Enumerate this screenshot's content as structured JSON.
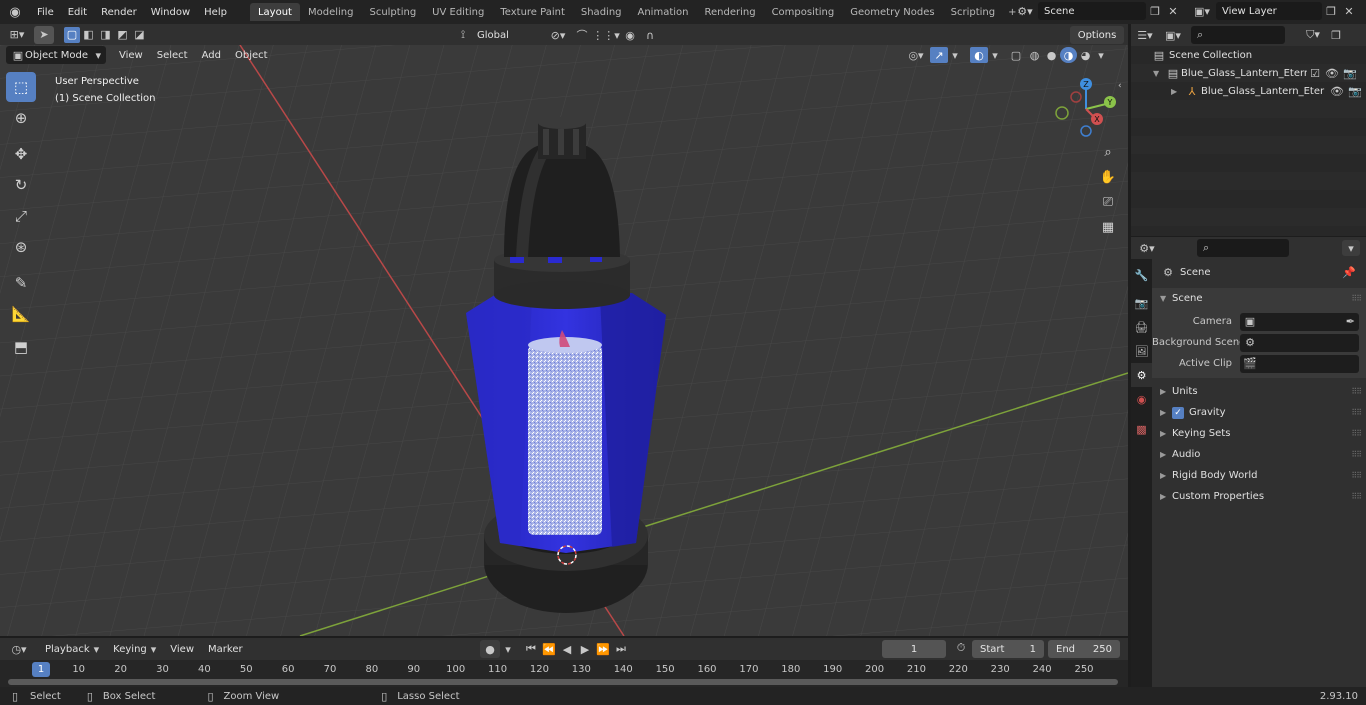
{
  "menubar": {
    "menus": [
      "File",
      "Edit",
      "Render",
      "Window",
      "Help"
    ],
    "workspaces": [
      "Layout",
      "Modeling",
      "Sculpting",
      "UV Editing",
      "Texture Paint",
      "Shading",
      "Animation",
      "Rendering",
      "Compositing",
      "Geometry Nodes",
      "Scripting"
    ],
    "active_workspace": "Layout",
    "add_tab": "+",
    "scene": "Scene",
    "view_layer": "View Layer"
  },
  "viewport": {
    "mode": "Object Mode",
    "menus": [
      "View",
      "Select",
      "Add",
      "Object"
    ],
    "transform_orientation": "Global",
    "options": "Options",
    "overlay_line1": "User Perspective",
    "overlay_line2": "(1) Scene Collection",
    "gizmo": {
      "x": "X",
      "y": "Y",
      "z": "Z"
    }
  },
  "outliner": {
    "search_placeholder": "",
    "root": "Scene Collection",
    "collection": "Blue_Glass_Lantern_Eternal_(",
    "object": "Blue_Glass_Lantern_Eter"
  },
  "properties": {
    "search_placeholder": "",
    "context": "Scene",
    "section": "Scene",
    "fields": [
      {
        "label": "Camera",
        "value": ""
      },
      {
        "label": "Background Scene",
        "value": ""
      },
      {
        "label": "Active Clip",
        "value": ""
      }
    ],
    "panels": [
      "Units",
      "Gravity",
      "Keying Sets",
      "Audio",
      "Rigid Body World",
      "Custom Properties"
    ],
    "gravity_checked": true
  },
  "timeline": {
    "menus": [
      "Playback",
      "Keying",
      "View",
      "Marker"
    ],
    "current_frame": "1",
    "start_label": "Start",
    "start": "1",
    "end_label": "End",
    "end": "250",
    "ticks": [
      "1",
      "10",
      "20",
      "30",
      "40",
      "50",
      "60",
      "70",
      "80",
      "90",
      "100",
      "110",
      "120",
      "130",
      "140",
      "150",
      "160",
      "170",
      "180",
      "190",
      "200",
      "210",
      "220",
      "230",
      "240",
      "250"
    ]
  },
  "statusbar": {
    "items": [
      "Select",
      "Box Select",
      "Zoom View",
      "Lasso Select"
    ],
    "version": "2.93.10"
  },
  "colors": {
    "accent": "#5680c2",
    "x_axis": "#d05050",
    "y_axis": "#8bc34a",
    "z_axis": "#3f8fe0",
    "glass": "#2a2ad0"
  }
}
